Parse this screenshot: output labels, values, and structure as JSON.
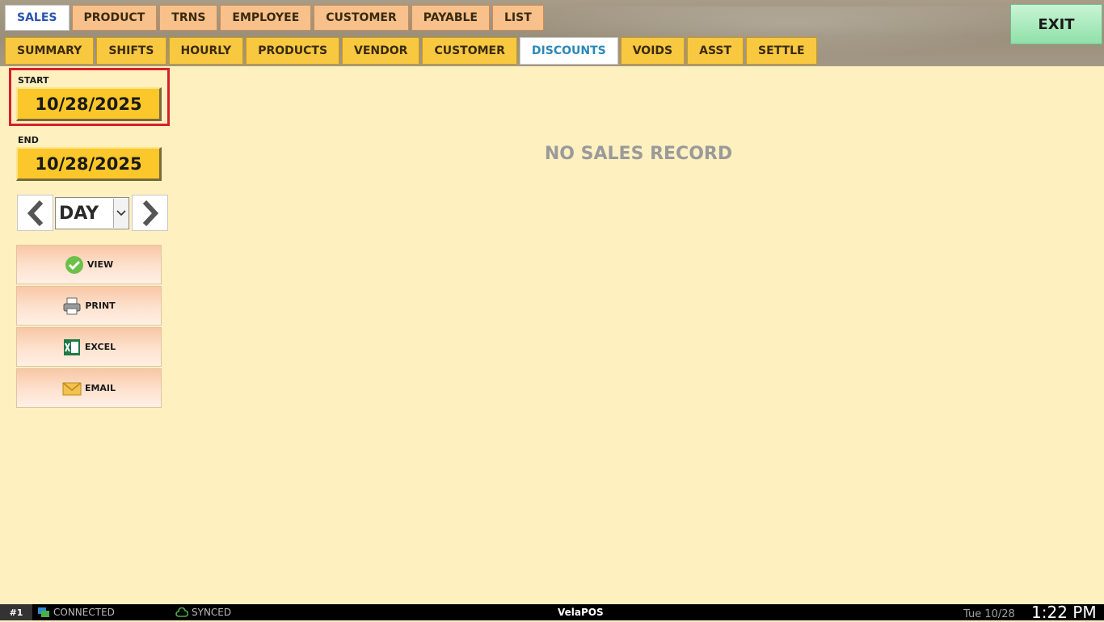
{
  "main_tabs": [
    {
      "label": "SALES",
      "active": true
    },
    {
      "label": "PRODUCT",
      "active": false
    },
    {
      "label": "TRNS",
      "active": false
    },
    {
      "label": "EMPLOYEE",
      "active": false
    },
    {
      "label": "CUSTOMER",
      "active": false
    },
    {
      "label": "PAYABLE",
      "active": false
    },
    {
      "label": "LIST",
      "active": false
    }
  ],
  "sub_tabs": [
    {
      "label": "SUMMARY",
      "active": false
    },
    {
      "label": "SHIFTS",
      "active": false
    },
    {
      "label": "HOURLY",
      "active": false
    },
    {
      "label": "PRODUCTS",
      "active": false
    },
    {
      "label": "VENDOR",
      "active": false
    },
    {
      "label": "CUSTOMER",
      "active": false
    },
    {
      "label": "DISCOUNTS",
      "active": true
    },
    {
      "label": "VOIDS",
      "active": false
    },
    {
      "label": "ASST",
      "active": false
    },
    {
      "label": "SETTLE",
      "active": false
    }
  ],
  "exit_label": "EXIT",
  "start": {
    "label": "START",
    "value": "10/28/2025"
  },
  "end": {
    "label": "END",
    "value": "10/28/2025"
  },
  "period": {
    "selected": "DAY"
  },
  "actions": {
    "view": "VIEW",
    "print": "PRINT",
    "excel": "EXCEL",
    "email": "EMAIL"
  },
  "message": "NO SALES RECORD",
  "status": {
    "terminal": "#1",
    "connection": "CONNECTED",
    "sync": "SYNCED",
    "brand": "VelaPOS",
    "date": "Tue 10/28",
    "time": "1:22 PM"
  },
  "colors": {
    "background": "#fff0c0",
    "main_tab": "#f8c08a",
    "sub_tab": "#f8c840",
    "date_button": "#fcc72a",
    "exit_button": "#8fe0a8",
    "highlight": "#d8202a"
  }
}
